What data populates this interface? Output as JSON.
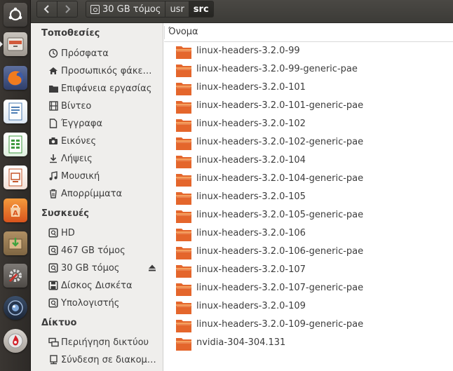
{
  "toolbar": {
    "breadcrumbs": [
      "30 GB τόμος",
      "usr",
      "src"
    ]
  },
  "sidebar": {
    "places_header": "Τοποθεσίες",
    "places": [
      {
        "label": "Πρόσφατα",
        "icon": "clock-icon"
      },
      {
        "label": "Προσωπικός φάκε…",
        "icon": "home-icon"
      },
      {
        "label": "Επιφάνεια εργασίας",
        "icon": "desktop-folder-icon"
      },
      {
        "label": "Βίντεο",
        "icon": "film-icon"
      },
      {
        "label": "Έγγραφα",
        "icon": "document-icon"
      },
      {
        "label": "Εικόνες",
        "icon": "camera-icon"
      },
      {
        "label": "Λήψεις",
        "icon": "download-icon"
      },
      {
        "label": "Μουσική",
        "icon": "music-icon"
      },
      {
        "label": "Απορρίμματα",
        "icon": "trash-icon"
      }
    ],
    "devices_header": "Συσκευές",
    "devices": [
      {
        "label": "HD",
        "icon": "drive-icon"
      },
      {
        "label": "467 GB τόμος",
        "icon": "drive-icon"
      },
      {
        "label": "30 GB τόμος",
        "icon": "drive-icon"
      },
      {
        "label": "Δίσκος Δισκέτα",
        "icon": "floppy-icon"
      },
      {
        "label": "Υπολογιστής",
        "icon": "drive-icon"
      }
    ],
    "network_header": "Δίκτυο",
    "network": [
      {
        "label": "Περιήγηση δικτύου",
        "icon": "network-icon"
      },
      {
        "label": "Σύνδεση σε διακομ…",
        "icon": "server-icon"
      }
    ]
  },
  "main": {
    "column_header": "Όνομα",
    "files": [
      "linux-headers-3.2.0-99",
      "linux-headers-3.2.0-99-generic-pae",
      "linux-headers-3.2.0-101",
      "linux-headers-3.2.0-101-generic-pae",
      "linux-headers-3.2.0-102",
      "linux-headers-3.2.0-102-generic-pae",
      "linux-headers-3.2.0-104",
      "linux-headers-3.2.0-104-generic-pae",
      "linux-headers-3.2.0-105",
      "linux-headers-3.2.0-105-generic-pae",
      "linux-headers-3.2.0-106",
      "linux-headers-3.2.0-106-generic-pae",
      "linux-headers-3.2.0-107",
      "linux-headers-3.2.0-107-generic-pae",
      "linux-headers-3.2.0-109",
      "linux-headers-3.2.0-109-generic-pae",
      "nvidia-304-304.131"
    ]
  },
  "colors": {
    "folder_orange": "#e4662c",
    "folder_light": "#f5a15f",
    "launcher_bg": "#2d2a27",
    "sidebar_bg": "#efeeec"
  }
}
